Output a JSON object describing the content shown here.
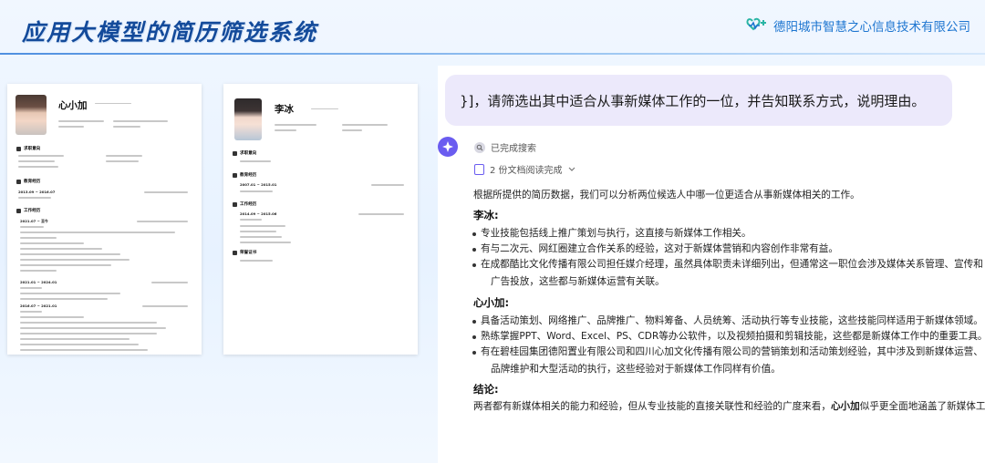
{
  "header": {
    "title": "应用大模型的简历筛选系统",
    "brand": "德阳城市智慧之心信息技术有限公司",
    "accent": "#134a9a"
  },
  "resumes": [
    {
      "name": "心小加",
      "sections": [
        "求职意向",
        "教育经历",
        "工作经历"
      ],
      "edu_period": "2013.09 ~ 2016.07",
      "work": [
        {
          "period": "2021.07 ~ 至今"
        },
        {
          "period": "2021.01 ~ 2024.01"
        },
        {
          "period": "2016.07 ~ 2021.01"
        }
      ]
    },
    {
      "name": "李冰",
      "sections": [
        "求职意向",
        "教育经历",
        "工作经历",
        "荣誉证书"
      ],
      "edu_period": "2007.01 ~ 2015.01",
      "work": [
        {
          "period": "2014.09 ~ 2015.06"
        }
      ]
    }
  ],
  "chat": {
    "question": "}]，请筛选出其中适合从事新媒体工作的一位，并告知联系方式，说明理由。",
    "search_status": "已完成搜索",
    "docs_status": "2 份文档阅读完成",
    "intro": "根据所提供的简历数据，我们可以分析两位候选人中哪一位更适合从事新媒体相关的工作。",
    "candidates": [
      {
        "heading": "李冰:",
        "bullets": [
          {
            "lines": [
              "专业技能包括线上推广策划与执行，这直接与新媒体工作相关。"
            ]
          },
          {
            "lines": [
              "有与二次元、网红圈建立合作关系的经验，这对于新媒体营销和内容创作非常有益。"
            ]
          },
          {
            "lines": [
              "在成都酷比文化传播有限公司担任媒介经理，虽然具体职责未详细列出，但通常这一职位会涉及媒体关系管理、宣传和",
              "广告投放，这些都与新媒体运营有关联。"
            ]
          }
        ]
      },
      {
        "heading": "心小加:",
        "bullets": [
          {
            "lines": [
              "具备活动策划、网络推广、品牌推广、物料筹备、人员统筹、活动执行等专业技能，这些技能同样适用于新媒体领域。"
            ]
          },
          {
            "lines": [
              "熟练掌握PPT、Word、Excel、PS、CDR等办公软件，以及视频拍摄和剪辑技能，这些都是新媒体工作中的重要工具。"
            ]
          },
          {
            "lines": [
              "有在碧桂园集团德阳置业有限公司和四川心加文化传播有限公司的营销策划和活动策划经验，其中涉及到新媒体运营、",
              "品牌维护和大型活动的执行，这些经验对于新媒体工作同样有价值。"
            ]
          }
        ]
      }
    ],
    "conclusion_heading": "结论:",
    "conclusion_text": "两者都有新媒体相关的能力和经验，但从专业技能的直接关联性和经验的广度来看，",
    "conclusion_bold": "心小加",
    "conclusion_tail": "似乎更全面地涵盖了新媒体工作"
  }
}
